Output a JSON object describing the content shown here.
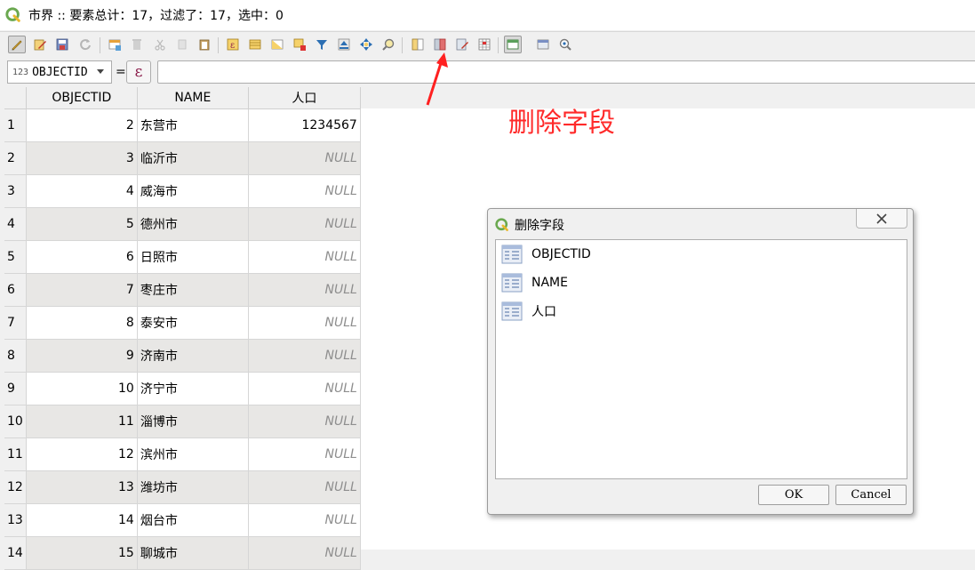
{
  "window": {
    "title": "市界 :: 要素总计：17，过滤了：17，选中：0"
  },
  "toolbar": {
    "buttons": [
      {
        "name": "toggle-editing",
        "icon": "pencil-icon"
      },
      {
        "name": "multi-edit",
        "icon": "multi-edit-icon"
      },
      {
        "name": "save-edits",
        "icon": "save-icon"
      },
      {
        "name": "reload",
        "icon": "reload-icon"
      },
      {
        "name": "add-feature",
        "icon": "add-feature-icon"
      },
      {
        "name": "delete-selected",
        "icon": "delete-icon"
      },
      {
        "name": "cut",
        "icon": "cut-icon"
      },
      {
        "name": "copy",
        "icon": "copy-icon"
      },
      {
        "name": "paste",
        "icon": "paste-icon"
      },
      {
        "name": "select-by-expression",
        "icon": "expression-select-icon"
      },
      {
        "name": "select-all",
        "icon": "select-all-icon"
      },
      {
        "name": "invert-selection",
        "icon": "invert-selection-icon"
      },
      {
        "name": "deselect-all",
        "icon": "deselect-icon"
      },
      {
        "name": "filter-select",
        "icon": "filter-icon"
      },
      {
        "name": "move-selection-top",
        "icon": "move-top-icon"
      },
      {
        "name": "pan-to-selected",
        "icon": "pan-icon"
      },
      {
        "name": "zoom-to-selected",
        "icon": "zoom-icon"
      },
      {
        "name": "new-field",
        "icon": "new-field-icon"
      },
      {
        "name": "delete-field",
        "icon": "delete-field-icon"
      },
      {
        "name": "field-calculator",
        "icon": "field-calculator-icon"
      },
      {
        "name": "conditional-formatting",
        "icon": "conditional-format-icon"
      },
      {
        "name": "dock-table",
        "icon": "dock-icon"
      },
      {
        "name": "actions",
        "icon": "actions-icon"
      },
      {
        "name": "identify",
        "icon": "identify-icon"
      }
    ]
  },
  "filterbar": {
    "field_type": "123",
    "field_name": "OBJECTID",
    "equals": "=",
    "expression_icon": "ε",
    "value": ""
  },
  "table": {
    "columns": [
      "OBJECTID",
      "NAME",
      "人口"
    ],
    "rows": [
      {
        "index": "1",
        "objectid": "2",
        "name": "东营市",
        "pop": "1234567",
        "null": false
      },
      {
        "index": "2",
        "objectid": "3",
        "name": "临沂市",
        "pop": "NULL",
        "null": true
      },
      {
        "index": "3",
        "objectid": "4",
        "name": "威海市",
        "pop": "NULL",
        "null": true
      },
      {
        "index": "4",
        "objectid": "5",
        "name": "德州市",
        "pop": "NULL",
        "null": true
      },
      {
        "index": "5",
        "objectid": "6",
        "name": "日照市",
        "pop": "NULL",
        "null": true
      },
      {
        "index": "6",
        "objectid": "7",
        "name": "枣庄市",
        "pop": "NULL",
        "null": true
      },
      {
        "index": "7",
        "objectid": "8",
        "name": "泰安市",
        "pop": "NULL",
        "null": true
      },
      {
        "index": "8",
        "objectid": "9",
        "name": "济南市",
        "pop": "NULL",
        "null": true
      },
      {
        "index": "9",
        "objectid": "10",
        "name": "济宁市",
        "pop": "NULL",
        "null": true
      },
      {
        "index": "10",
        "objectid": "11",
        "name": "淄博市",
        "pop": "NULL",
        "null": true
      },
      {
        "index": "11",
        "objectid": "12",
        "name": "滨州市",
        "pop": "NULL",
        "null": true
      },
      {
        "index": "12",
        "objectid": "13",
        "name": "潍坊市",
        "pop": "NULL",
        "null": true
      },
      {
        "index": "13",
        "objectid": "14",
        "name": "烟台市",
        "pop": "NULL",
        "null": true
      },
      {
        "index": "14",
        "objectid": "15",
        "name": "聊城市",
        "pop": "NULL",
        "null": true
      }
    ]
  },
  "annotation": {
    "text": "删除字段",
    "color": "#ff2a2a"
  },
  "dialog": {
    "title": "删除字段",
    "fields": [
      "OBJECTID",
      "NAME",
      "人口"
    ],
    "ok_label": "OK",
    "cancel_label": "Cancel"
  }
}
